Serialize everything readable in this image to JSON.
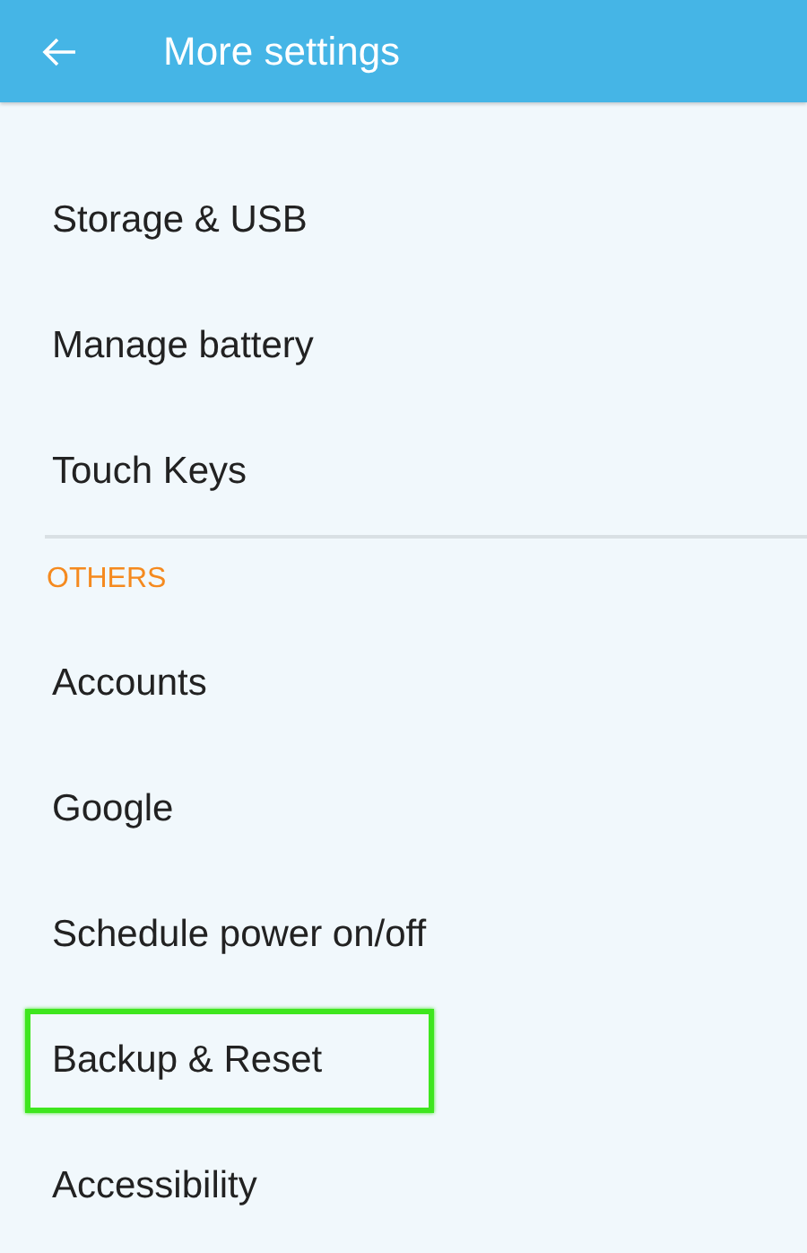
{
  "app_bar": {
    "title": "More settings"
  },
  "sections": [
    {
      "items": [
        {
          "label": "Storage & USB",
          "highlighted": false
        },
        {
          "label": "Manage battery",
          "highlighted": false
        },
        {
          "label": "Touch Keys",
          "highlighted": false
        }
      ]
    },
    {
      "header": "OTHERS",
      "items": [
        {
          "label": "Accounts",
          "highlighted": false
        },
        {
          "label": "Google",
          "highlighted": false
        },
        {
          "label": "Schedule power on/off",
          "highlighted": false
        },
        {
          "label": "Backup & Reset",
          "highlighted": true
        },
        {
          "label": "Accessibility",
          "highlighted": false
        }
      ]
    }
  ]
}
